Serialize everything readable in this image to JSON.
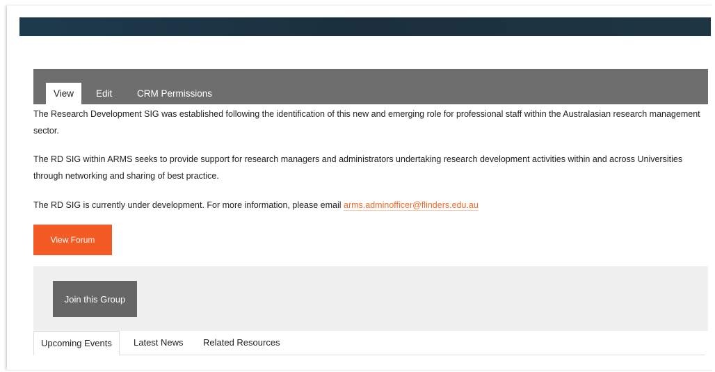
{
  "tabs": {
    "view": "View",
    "edit": "Edit",
    "crm_permissions": "CRM Permissions"
  },
  "content": {
    "paragraph_1": "The Research Development SIG was established following the identification of this new and emerging role for professional staff within the Australasian research management sector.",
    "paragraph_2": "The RD SIG within ARMS seeks to provide support for research managers and administrators undertaking research development activities within and across Universities through networking and sharing of best practice.",
    "paragraph_3_prefix": "The RD SIG is currently under development. For more information, please email ",
    "email": "arms.adminofficer@flinders.edu.au"
  },
  "buttons": {
    "view_forum": "View Forum",
    "join_group": "Join this Group"
  },
  "lower_tabs": {
    "upcoming_events": "Upcoming Events",
    "latest_news": "Latest News",
    "related_resources": "Related Resources"
  },
  "colors": {
    "banner": "#1d3a4d",
    "tab_bar": "#6e6e6e",
    "accent_orange": "#f45a24",
    "link_orange": "#f0692a",
    "join_button": "#666666",
    "panel_bg": "#f0f0f0"
  }
}
